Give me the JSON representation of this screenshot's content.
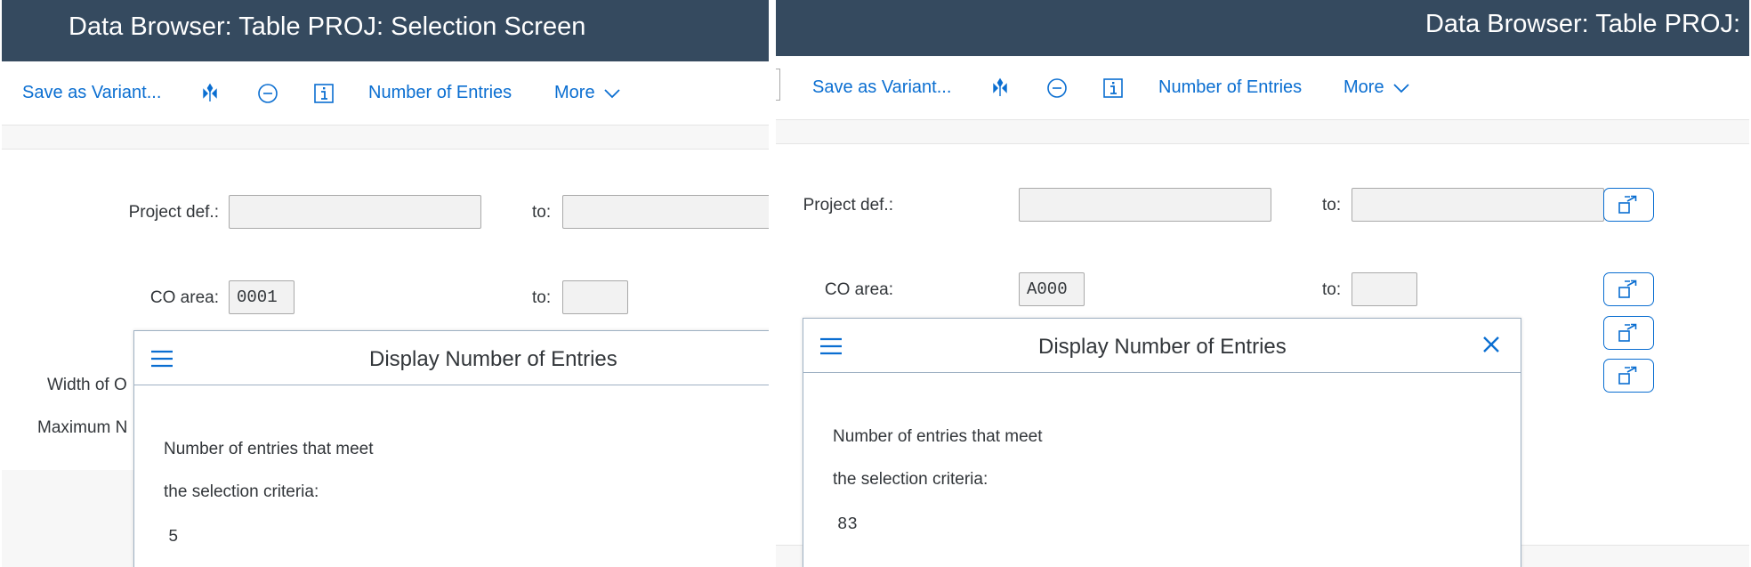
{
  "left": {
    "title": "Data Browser: Table PROJ: Selection Screen",
    "toolbar": {
      "save_variant": "Save as Variant...",
      "icons": [
        "variant-tree-icon",
        "minus-circle-icon",
        "info-icon"
      ],
      "number_of_entries": "Number of Entries",
      "more": "More"
    },
    "form": {
      "project_def_label": "Project def.:",
      "project_def_from": "",
      "project_def_to_label": "to:",
      "project_def_to": "",
      "co_area_label": "CO area:",
      "co_area_from": "0001",
      "co_area_to_label": "to:",
      "co_area_to": "",
      "width_label_partial": "Width of O",
      "max_label_partial": "Maximum N"
    },
    "dialog": {
      "title": "Display Number of Entries",
      "line1": "Number of entries that meet",
      "line2": "the selection criteria:",
      "value": "5"
    }
  },
  "right": {
    "title": "Data Browser: Table PROJ:",
    "toolbar": {
      "save_variant": "Save as Variant...",
      "number_of_entries": "Number of Entries",
      "more": "More"
    },
    "form": {
      "project_def_label": "Project def.:",
      "project_def_from": "",
      "project_def_to_label": "to:",
      "project_def_to": "",
      "co_area_label": "CO area:",
      "co_area_from": "A000",
      "co_area_to_label": "to:",
      "co_area_to": "",
      "multiple_selection_buttons": 4
    },
    "dialog": {
      "title": "Display Number of Entries",
      "line1": "Number of entries that meet",
      "line2": "the selection criteria:",
      "value": "83"
    }
  },
  "colors": {
    "titlebar": "#354a5f",
    "link": "#0a6ed1",
    "text": "#32363a",
    "field_bg": "#f2f2f2",
    "dialog_border": "#9fb1c3"
  }
}
